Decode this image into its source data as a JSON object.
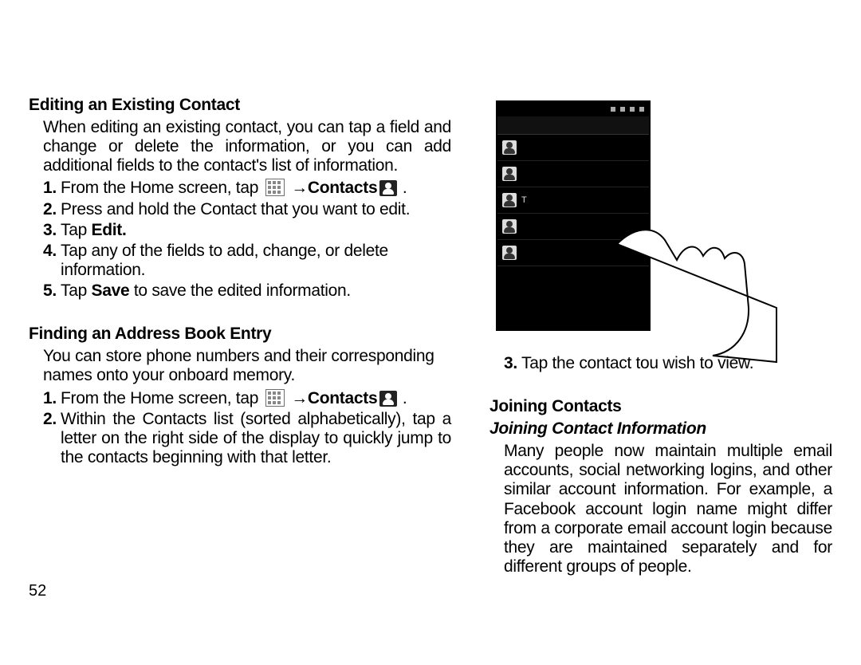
{
  "pageNumber": "52",
  "leftCol": {
    "section1": {
      "heading": "Editing an Existing Contact",
      "intro": "When editing an existing contact, you can tap a field and change or delete the information, or you can add additional fields to the contact's list of information.",
      "steps": [
        {
          "num": "1.",
          "pre": "From the Home screen, tap ",
          "mid1": " ",
          "arrow": "→",
          "bold": "Contacts",
          "post": " ."
        },
        {
          "num": "2.",
          "text": "Press and hold the Contact that you want to edit."
        },
        {
          "num": "3.",
          "pre": "Tap ",
          "bold": "Edit.",
          "post": ""
        },
        {
          "num": "4.",
          "text": "Tap any of the fields to add, change, or delete information."
        },
        {
          "num": "5.",
          "pre": "Tap ",
          "bold": "Save",
          "post": " to save the edited information."
        }
      ]
    },
    "section2": {
      "heading": "Finding an Address Book Entry",
      "intro": "You can store phone numbers and their corresponding names onto your onboard memory.",
      "steps": [
        {
          "num": "1.",
          "pre": "From the Home screen, tap ",
          "arrow": "→",
          "bold": "Contacts",
          "post": " ."
        },
        {
          "num": "2.",
          "text": "Within the Contacts list (sorted alphabetically), tap a letter on the right side of the display to quickly jump to the contacts beginning with that letter."
        }
      ]
    }
  },
  "rightCol": {
    "step3": {
      "num": "3.",
      "text": "Tap the contact tou wish to view."
    },
    "section": {
      "heading": "Joining Contacts",
      "subheading": "Joining Contact Information",
      "para": "Many people now maintain multiple email accounts, social networking logins, and other similar account information. For example, a Facebook account login name might differ from a corporate email account login because they are maintained separately and for different groups of people."
    }
  }
}
